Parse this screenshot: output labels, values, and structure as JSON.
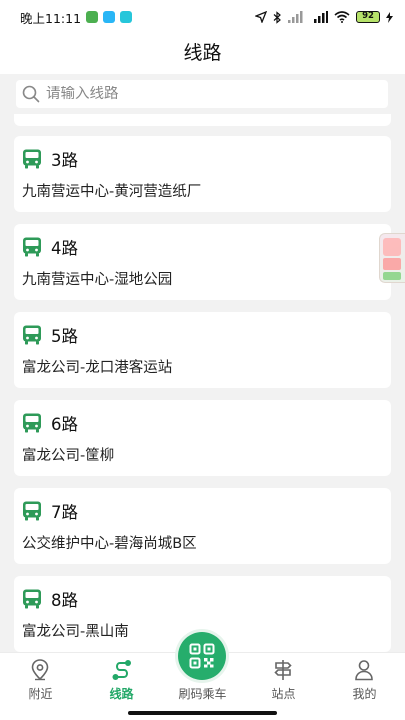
{
  "status_bar": {
    "time": "晚上11:11",
    "battery": "92",
    "app_icon_colors": [
      "#4caf50",
      "#29b6f6",
      "#26c6da"
    ]
  },
  "header": {
    "title": "线路"
  },
  "search": {
    "placeholder": "请输入线路",
    "value": ""
  },
  "routes": [
    {
      "name": "3路",
      "desc": "九南营运中心-黄河营造纸厂"
    },
    {
      "name": "4路",
      "desc": "九南营运中心-湿地公园"
    },
    {
      "name": "5路",
      "desc": "富龙公司-龙口港客运站"
    },
    {
      "name": "6路",
      "desc": "富龙公司-筐柳"
    },
    {
      "name": "7路",
      "desc": "公交维护中心-碧海尚城B区"
    },
    {
      "name": "8路",
      "desc": "富龙公司-黑山南"
    }
  ],
  "tabs": [
    {
      "label": "附近",
      "icon": "location-pin-icon"
    },
    {
      "label": "线路",
      "icon": "route-icon",
      "active": true
    },
    {
      "label": "刷码乘车",
      "icon": "qr-code-icon"
    },
    {
      "label": "站点",
      "icon": "signpost-icon"
    },
    {
      "label": "我的",
      "icon": "user-icon"
    }
  ],
  "colors": {
    "accent": "#26ad6c",
    "background": "#f2f2f2"
  }
}
